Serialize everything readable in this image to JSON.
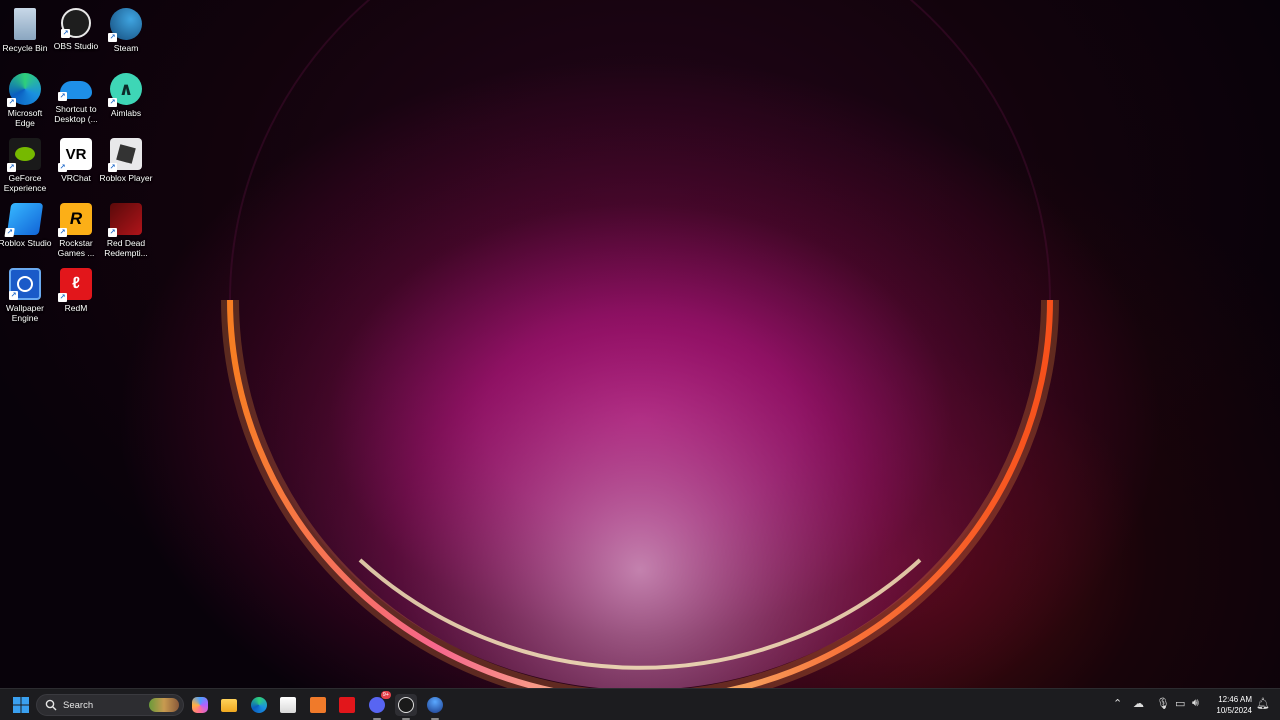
{
  "desktop": {
    "icons": [
      {
        "label": "Recycle Bin",
        "icon": "recycle-bin-icon"
      },
      {
        "label": "OBS Studio",
        "icon": "obs-studio-icon"
      },
      {
        "label": "Steam",
        "icon": "steam-icon"
      },
      {
        "label": "Microsoft Edge",
        "icon": "edge-icon"
      },
      {
        "label": "Shortcut to Desktop (...",
        "icon": "onedrive-icon"
      },
      {
        "label": "Aimlabs",
        "icon": "aimlabs-icon"
      },
      {
        "label": "GeForce Experience",
        "icon": "geforce-icon"
      },
      {
        "label": "VRChat",
        "icon": "vrchat-icon"
      },
      {
        "label": "Roblox Player",
        "icon": "roblox-player-icon"
      },
      {
        "label": "Roblox Studio",
        "icon": "roblox-studio-icon"
      },
      {
        "label": "Rockstar Games ...",
        "icon": "rockstar-icon"
      },
      {
        "label": "Red Dead Redempti...",
        "icon": "red-dead-icon"
      },
      {
        "label": "Wallpaper Engine",
        "icon": "wallpaper-engine-icon"
      },
      {
        "label": "RedM",
        "icon": "redm-icon"
      }
    ]
  },
  "taskbar": {
    "search_placeholder": "Search",
    "clock_time": "12:46 AM",
    "clock_date": "10/5/2024",
    "pinned": [
      "start-icon",
      "copilot-icon",
      "file-explorer-icon",
      "edge-icon",
      "store-icon",
      "aimlabs-taskbar-icon",
      "redm-taskbar-icon",
      "discord-icon",
      "obs-taskbar-icon",
      "app-taskbar-icon"
    ],
    "discord_badge": "9+"
  },
  "colors": {
    "taskbar": "#1c1c1f",
    "accent": "#0078d4"
  }
}
